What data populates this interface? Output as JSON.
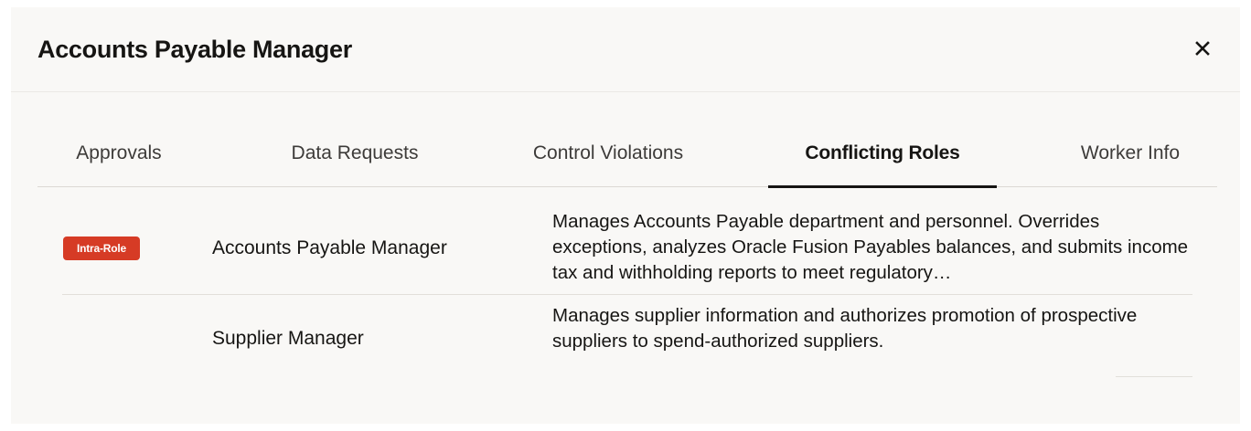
{
  "dialog": {
    "title": "Accounts Payable Manager",
    "close_icon": "close-icon"
  },
  "tabs": [
    {
      "label": "Approvals",
      "active": false
    },
    {
      "label": "Data Requests",
      "active": false
    },
    {
      "label": "Control Violations",
      "active": false
    },
    {
      "label": "Conflicting Roles",
      "active": true
    },
    {
      "label": "Worker Info",
      "active": false
    }
  ],
  "roles": [
    {
      "badge": "Intra-Role",
      "name": "Accounts Payable Manager",
      "description": "Manages Accounts Payable department and personnel. Overrides exceptions, analyzes Oracle Fusion Payables balances, and submits income tax and withholding reports to meet regulatory…"
    },
    {
      "badge": "",
      "name": "Supplier Manager",
      "description": "Manages supplier information and authorizes promotion of prospective suppliers to spend-authorized suppliers."
    }
  ],
  "colors": {
    "badge_background": "#d63b25",
    "active_tab_underline": "#161513",
    "dialog_background": "#f9f8f6"
  }
}
